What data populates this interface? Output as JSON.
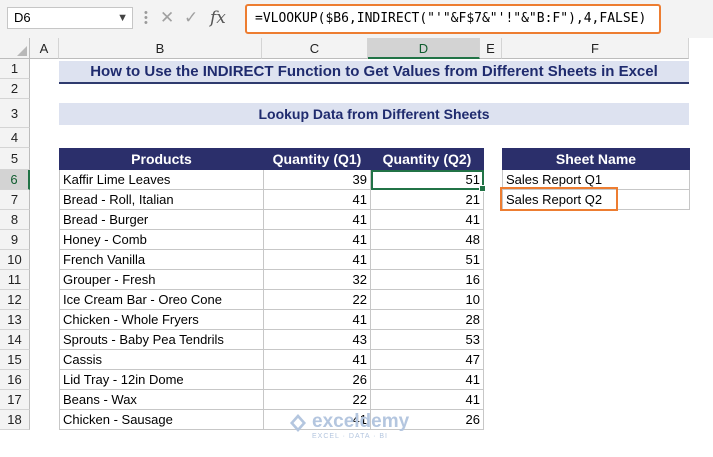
{
  "formula_bar": {
    "name_box": "D6",
    "formula": "=VLOOKUP($B6,INDIRECT(\"'\"&F$7&\"'!\"&\"B:F\"),4,FALSE)"
  },
  "columns": [
    "A",
    "B",
    "C",
    "D",
    "E",
    "F"
  ],
  "rows": [
    "1",
    "2",
    "3",
    "4",
    "5",
    "6",
    "7",
    "8",
    "9",
    "10",
    "11",
    "12",
    "13",
    "14",
    "15",
    "16",
    "17",
    "18"
  ],
  "title": "How to Use the INDIRECT Function to Get Values from Different Sheets in Excel",
  "subtitle": "Lookup Data from Different Sheets",
  "table": {
    "headers": [
      "Products",
      "Quantity (Q1)",
      "Quantity (Q2)"
    ],
    "rows": [
      [
        "Kaffir Lime Leaves",
        "39",
        "51"
      ],
      [
        "Bread - Roll, Italian",
        "41",
        "21"
      ],
      [
        "Bread - Burger",
        "41",
        "41"
      ],
      [
        "Honey - Comb",
        "41",
        "48"
      ],
      [
        "French Vanilla",
        "41",
        "51"
      ],
      [
        "Grouper - Fresh",
        "32",
        "16"
      ],
      [
        "Ice Cream Bar - Oreo Cone",
        "22",
        "10"
      ],
      [
        "Chicken - Whole Fryers",
        "41",
        "28"
      ],
      [
        "Sprouts - Baby Pea Tendrils",
        "43",
        "53"
      ],
      [
        "Cassis",
        "41",
        "47"
      ],
      [
        "Lid Tray - 12in Dome",
        "26",
        "41"
      ],
      [
        "Beans - Wax",
        "22",
        "41"
      ],
      [
        "Chicken - Sausage",
        "41",
        "26"
      ]
    ]
  },
  "sheet_table": {
    "header": "Sheet Name",
    "rows": [
      "Sales Report Q1",
      "Sales Report Q2"
    ]
  },
  "watermark": {
    "name": "exceldemy",
    "tagline": "EXCEL · DATA · BI"
  },
  "colors": {
    "header_fill": "#2b2f6b",
    "title_fill": "#dde2f0",
    "highlight": "#ed7d31",
    "selection": "#217346"
  }
}
